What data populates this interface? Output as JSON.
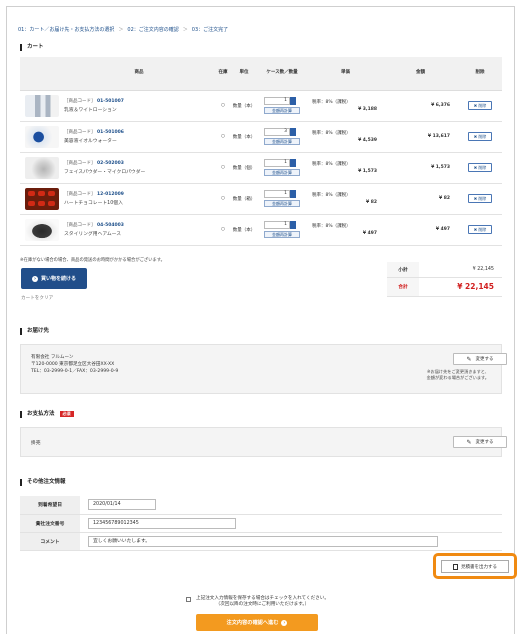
{
  "breadcrumb": {
    "step1": "01：カート／お届け先・お支払方法の選択",
    "step2": "02：ご注文内容の確認",
    "step3": "03：ご注文完了"
  },
  "cart": {
    "title": "カート",
    "headers": {
      "product": "商品",
      "stock": "在庫",
      "unit": "単位",
      "qty": "ケース数／数量",
      "price": "単価",
      "amount": "金額",
      "delete": "削除"
    },
    "items": [
      {
        "code_label": "［商品コード］",
        "code": "01-501007",
        "name": "乳液＆ワイトローション",
        "stock": "○",
        "unit": "数量（本）",
        "qty": "1",
        "recalc": "金額再計算",
        "tax": "税率：8%（課税）",
        "price": "¥ 3,188",
        "amount": "¥ 6,376",
        "delete": "削除",
        "thumb": "lotion-bottles-image"
      },
      {
        "code_label": "［商品コード］",
        "code": "01-501006",
        "name": "美容液イオルウォーター",
        "stock": "○",
        "unit": "数量（本）",
        "qty": "3",
        "recalc": "金額再計算",
        "tax": "税率：8%（課税）",
        "price": "¥ 4,539",
        "amount": "¥ 13,617",
        "delete": "削除",
        "thumb": "serum-bottles-image"
      },
      {
        "code_label": "［商品コード］",
        "code": "02-502003",
        "name": "フェイスパウダー・マイクロパウダー",
        "stock": "○",
        "unit": "数量（個）",
        "qty": "1",
        "recalc": "金額再計算",
        "tax": "税率：8%（課税）",
        "price": "¥ 1,573",
        "amount": "¥ 1,573",
        "delete": "削除",
        "thumb": "powder-puff-image"
      },
      {
        "code_label": "［商品コード］",
        "code": "12-012009",
        "name": "ハートチョコレート10個入",
        "stock": "○",
        "unit": "数量（箱）",
        "qty": "1",
        "recalc": "金額再計算",
        "tax": "税率：8%（課税）",
        "price": "¥ 82",
        "amount": "¥ 82",
        "delete": "削除",
        "thumb": "heart-chocolate-image"
      },
      {
        "code_label": "［商品コード］",
        "code": "04-504003",
        "name": "スタイリング用ヘアムース",
        "stock": "○",
        "unit": "数量（本）",
        "qty": "1",
        "recalc": "金額再計算",
        "tax": "税率：8%（課税）",
        "price": "¥ 497",
        "amount": "¥ 497",
        "delete": "削除",
        "thumb": "hair-mousse-image"
      }
    ],
    "note": "※在庫がない場合の場合、商品の発送のお時間がかかる場合がございます。",
    "continue_label": "買い物を続ける",
    "clear_label": "カートをクリア"
  },
  "totals": {
    "subtotal_label": "小計",
    "subtotal": "¥ 22,145",
    "total_label": "合計",
    "total": "¥ 22,145"
  },
  "delivery": {
    "title": "お届け先",
    "company": "有限会社 フルムーン",
    "address": "〒120-0000 東京都足立区大谷田XX-XX",
    "tel": "TEL：03-2999-0-1／FAX：03-2999-0-9",
    "change_label": "変更する",
    "note_line1": "※お届け先をご変更頂きますと、",
    "note_line2": "金額が変わる場合がございます。"
  },
  "payment": {
    "title": "お支払方法",
    "required": "必須",
    "method": "掛売",
    "change_label": "変更する"
  },
  "other": {
    "title": "その他注文情報",
    "rows": [
      {
        "label": "到着希望日",
        "value": "2020/01/14"
      },
      {
        "label": "貴社注文番号",
        "value": "123456789012345"
      },
      {
        "label": "コメント",
        "value": "宜しくお願いいたします。"
      }
    ],
    "receipt_label": "見積書を出力する"
  },
  "footer": {
    "save_line1": "上記注文入力情報を保存する場合はチェックを入れてください。",
    "save_line2": "（次回以降の注文時にご利用いただけます。）",
    "confirm_label": "注文内容の確認へ進む"
  },
  "colors": {
    "accent_blue": "#214e8a",
    "highlight_orange": "#f08a12",
    "total_red": "#d11f1f",
    "confirm_orange": "#f39a1f"
  }
}
